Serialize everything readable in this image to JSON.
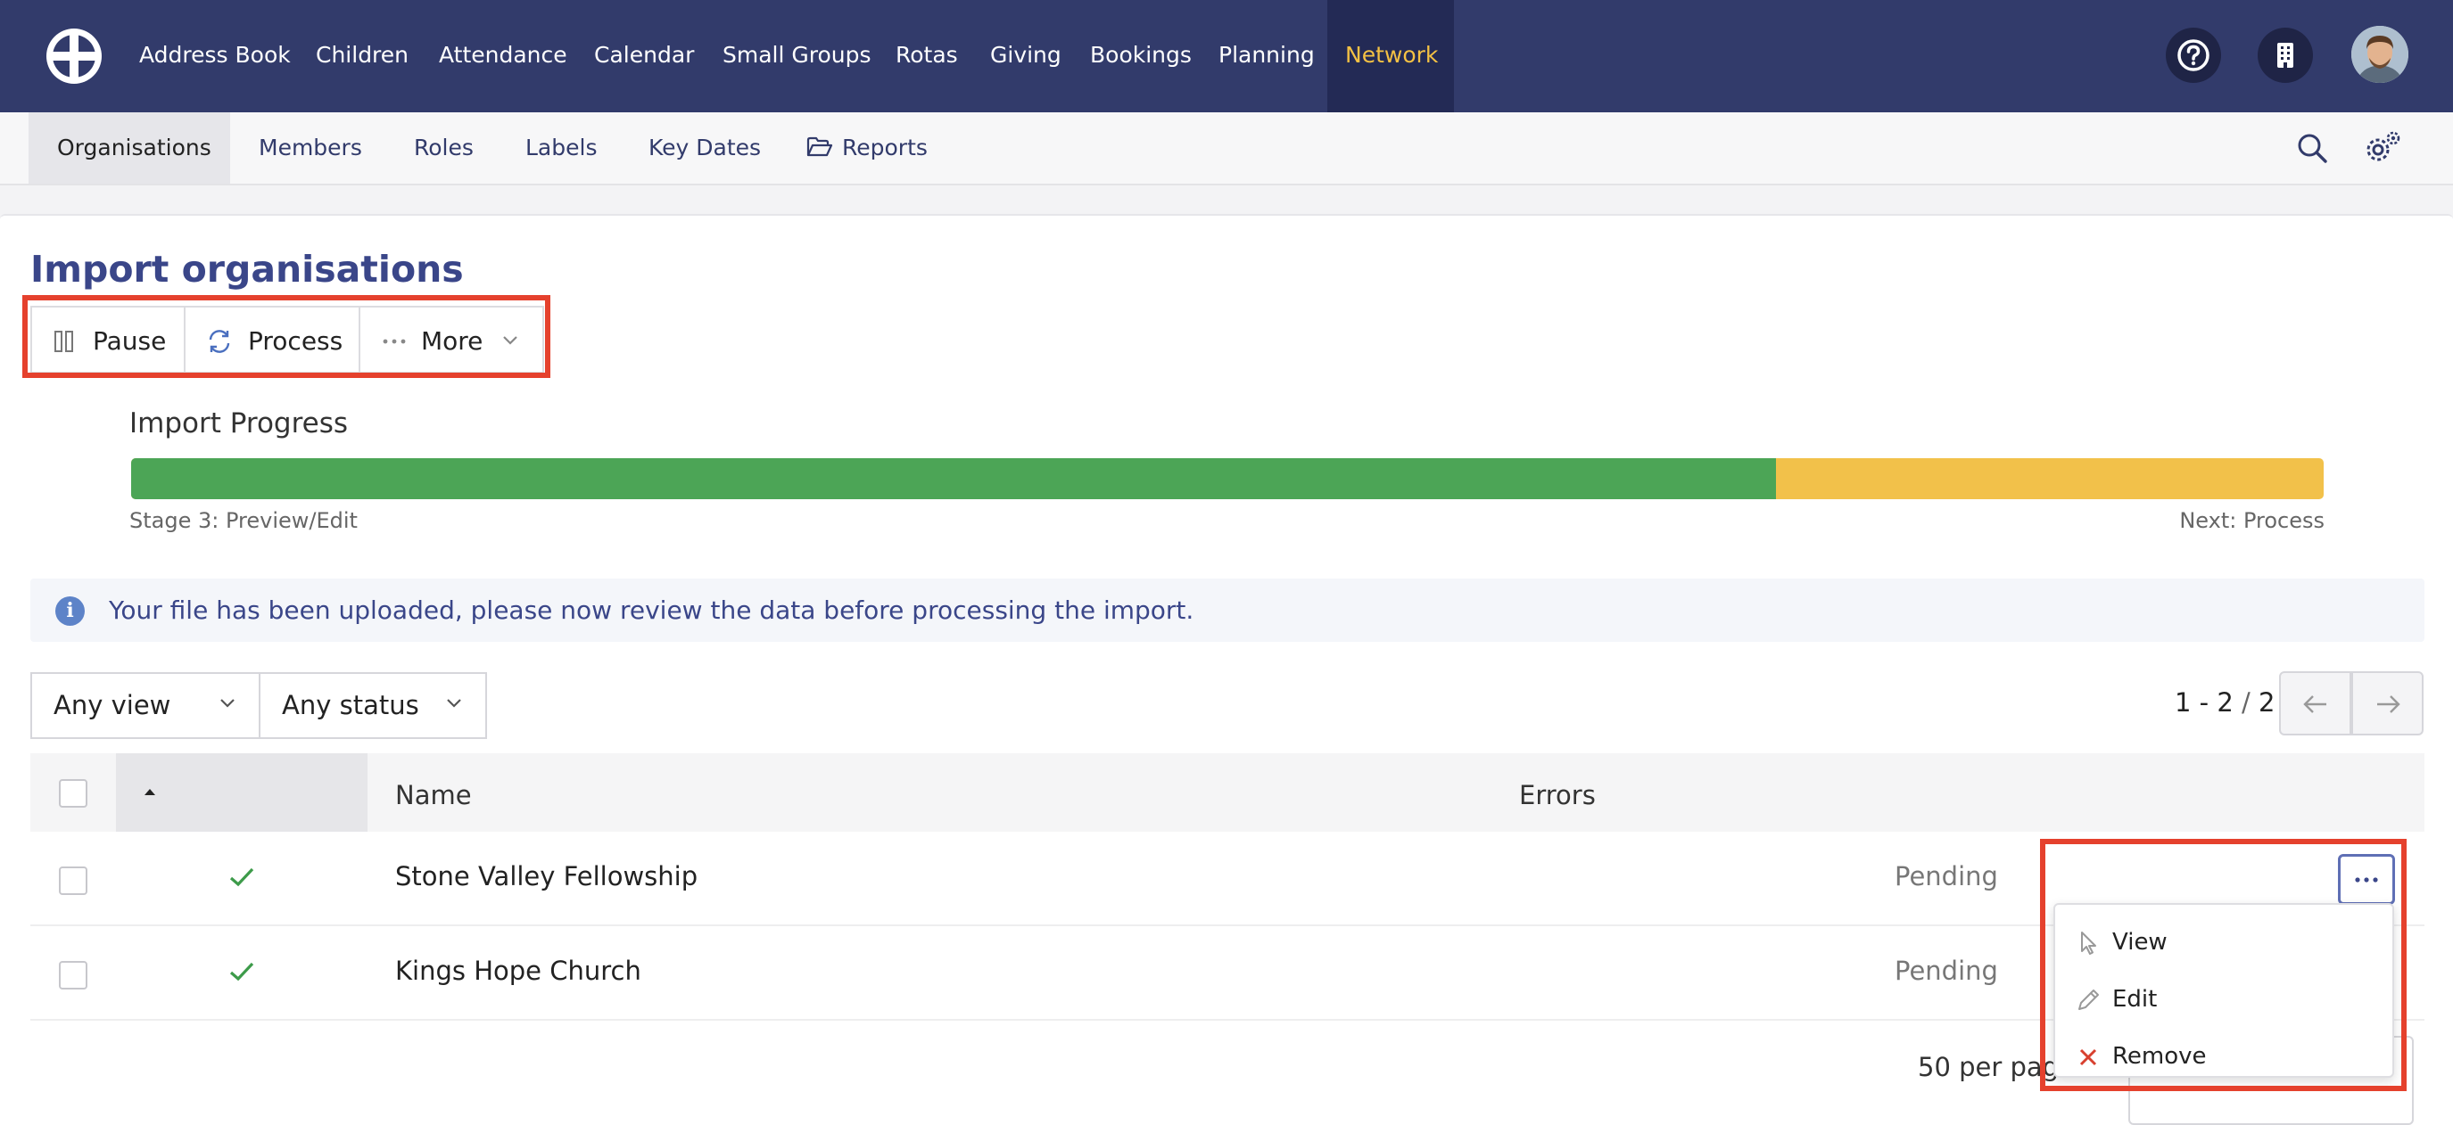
{
  "topnav": {
    "items": [
      {
        "label": "Address Book"
      },
      {
        "label": "Children"
      },
      {
        "label": "Attendance"
      },
      {
        "label": "Calendar"
      },
      {
        "label": "Small Groups"
      },
      {
        "label": "Rotas"
      },
      {
        "label": "Giving"
      },
      {
        "label": "Bookings"
      },
      {
        "label": "Planning"
      },
      {
        "label": "Network"
      }
    ],
    "active_item": "Network",
    "icons": [
      "help-icon",
      "building-icon",
      "user-avatar"
    ]
  },
  "subnav": {
    "items": [
      {
        "label": "Organisations"
      },
      {
        "label": "Members"
      },
      {
        "label": "Roles"
      },
      {
        "label": "Labels"
      },
      {
        "label": "Key Dates"
      },
      {
        "label": "Reports",
        "icon": "folder-open-icon"
      }
    ],
    "active_item": "Organisations",
    "icons": [
      "search-icon",
      "settings-cogs-icon"
    ]
  },
  "page": {
    "title": "Import organisations"
  },
  "toolbar": {
    "pause_label": "Pause",
    "process_label": "Process",
    "more_label": "More"
  },
  "progress": {
    "title": "Import Progress",
    "stage_label": "Stage 3: Preview/Edit",
    "next_label": "Next: Process",
    "completed_fraction": 0.75,
    "colors": {
      "done": "#4ca556",
      "remaining": "#f2c14a"
    }
  },
  "info": {
    "message": "Your file has been uploaded, please now review the data before processing the import."
  },
  "filters": {
    "view": "Any view",
    "status": "Any status"
  },
  "pagination": {
    "range": "1 - 2",
    "total": "2",
    "per_page_label": "50 per page"
  },
  "table": {
    "columns": [
      "Name",
      "Errors"
    ],
    "rows": [
      {
        "name": "Stone Valley Fellowship",
        "status": "Pending",
        "valid": true
      },
      {
        "name": "Kings Hope Church",
        "status": "Pending",
        "valid": true
      }
    ]
  },
  "row_menu": {
    "items": [
      {
        "label": "View",
        "icon": "pointer-icon"
      },
      {
        "label": "Edit",
        "icon": "pencil-icon"
      },
      {
        "label": "Remove",
        "icon": "close-icon"
      }
    ]
  },
  "colors": {
    "nav_bg": "#323b6b",
    "nav_active": "#f4c144",
    "title": "#3a4689",
    "highlight": "#e5412d"
  }
}
